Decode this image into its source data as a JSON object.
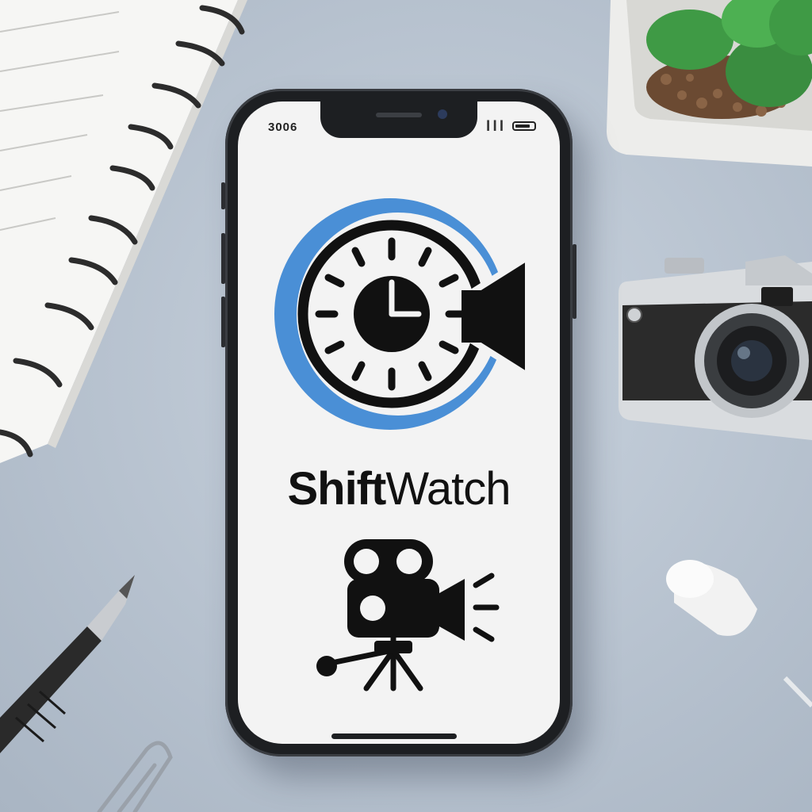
{
  "phone": {
    "status_time": "3006",
    "status_signal": "▎▎▎"
  },
  "app": {
    "name_bold": "Shift",
    "name_light": "Watch",
    "logo_icon": "clock-camera-icon",
    "secondary_icon": "movie-camera-icon"
  },
  "colors": {
    "brand_blue": "#4a8fd6",
    "icon_black": "#111111",
    "background": "#b9c4d1"
  },
  "scene": {
    "objects": [
      "spiral-notebook",
      "potted-succulent",
      "film-camera",
      "fountain-pen",
      "paper-clip",
      "tape-roll"
    ]
  }
}
